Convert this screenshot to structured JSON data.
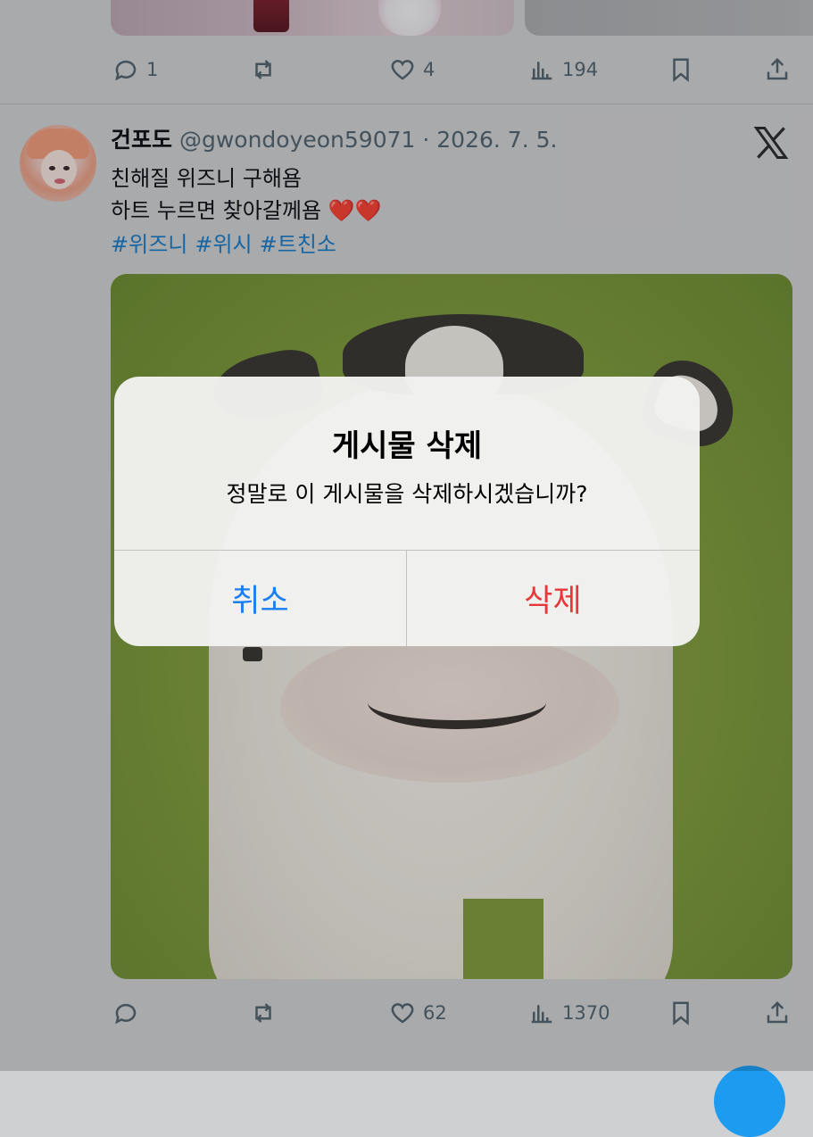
{
  "prev_tweet": {
    "actions": {
      "replies": "1",
      "reposts": "",
      "likes": "4",
      "views": "194"
    }
  },
  "tweet": {
    "display_name": "건포도",
    "meta": "@gwondoyeon59071 · 2026. 7. 5.",
    "lines": [
      "친해질 위즈니 구해욤",
      "하트 누르면 찾아갈께욤 ❤️❤️"
    ],
    "hashtags": [
      "#위즈니",
      "#위시",
      "#트친소"
    ],
    "actions": {
      "replies": "",
      "reposts": "",
      "likes": "62",
      "views": "1370"
    }
  },
  "alert": {
    "title": "게시물 삭제",
    "message": "정말로 이 게시물을 삭제하시겠습니까?",
    "cancel_label": "취소",
    "delete_label": "삭제"
  },
  "colors": {
    "link": "#1d7cc6",
    "cancel": "#1a7ef2",
    "destructive": "#e8363b",
    "icon": "#536471"
  },
  "icons": [
    "reply-icon",
    "repost-icon",
    "like-icon",
    "views-icon",
    "bookmark-icon",
    "share-icon",
    "x-logo-icon"
  ]
}
